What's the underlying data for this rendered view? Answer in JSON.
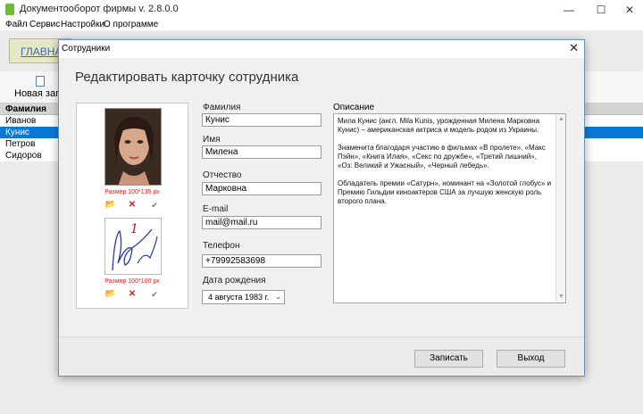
{
  "app": {
    "title": "Документооборот фирмы v. 2.8.0.0",
    "menu": [
      "Файл",
      "Сервис",
      "Настройки",
      "О программе"
    ],
    "controls": {
      "minimize": "—",
      "maximize": "☐",
      "close": "✕"
    }
  },
  "main": {
    "home_link": "ГЛАВНАЯ",
    "new_record": "Новая запи",
    "grid_header": "Фамилия",
    "rows": [
      "Иванов",
      "Кунис",
      "Петров",
      "Сидоров"
    ],
    "selected_row": "Кунис",
    "selection_color": "#0b78d7"
  },
  "dialog": {
    "title": "Сотрудники",
    "close": "✕",
    "heading": "Редактировать карточку сотрудника",
    "photo": {
      "size_label": "Размер 100*135 px"
    },
    "signature": {
      "size_label": "Размер 100*100 px",
      "mark": "1"
    },
    "icons": {
      "open": "folder-icon",
      "delete": "x-icon",
      "apply": "check-icon"
    },
    "fields": {
      "last_name_label": "Фамилия",
      "last_name": "Кунис",
      "first_name_label": "Имя",
      "first_name": "Милена",
      "patronymic_label": "Отчество",
      "patronymic": "Марковна",
      "email_label": "E-mail",
      "email": "mail@mail.ru",
      "phone_label": "Телефон",
      "phone": "+79992583698",
      "birth_label": "Дата рождения",
      "birth_date": "4  августа  1983 г."
    },
    "description": {
      "label": "Описание",
      "p1": "Мила Кунис (англ. Mila Kunis, урожденная Милена Марковна Кунис) – американская актриса и модель родом из Украины.",
      "p2": "Знаменита благодаря участию в фильмах «В пролете», «Макс Пэйн», «Книга Илая», «Секс по дружбе», «Третий лишний», «Оз: Великий и Ужасный», «Черный лебедь».",
      "p3": "Обладатель премии «Сатурн», номинант на «Золотой глобус» и Премию Гильдии киноактеров США за лучшую женскую роль второго плана."
    },
    "buttons": {
      "save": "Записать",
      "exit": "Выход"
    }
  }
}
